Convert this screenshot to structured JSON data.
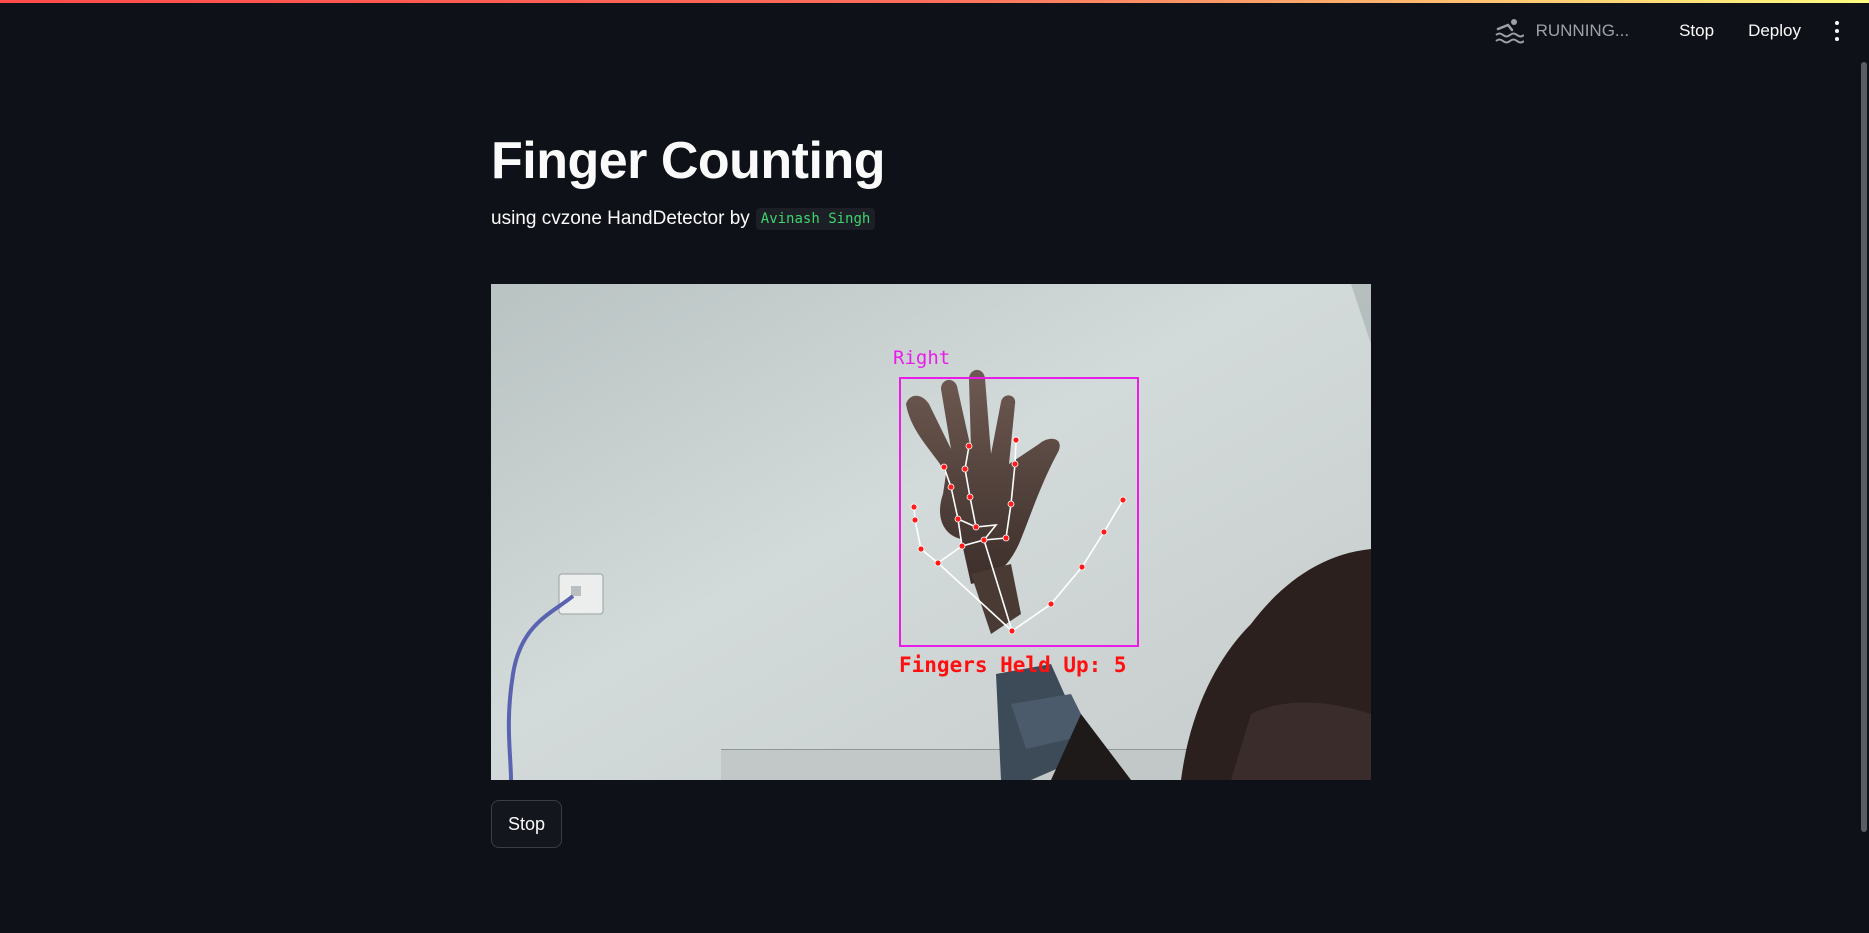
{
  "toolbar": {
    "status_icon": "swimmer-icon",
    "status_text": "RUNNING...",
    "stop_label": "Stop",
    "deploy_label": "Deploy",
    "menu_icon": "kebab-menu-icon"
  },
  "main": {
    "title": "Finger Counting",
    "subtitle_text": "using cvzone HandDetector by",
    "author": "Avinash Singh",
    "video": {
      "hand_label": "Right",
      "count_text": "Fingers Held Up: 5"
    },
    "stop_button_label": "Stop"
  },
  "colors": {
    "background": "#0e1117",
    "accent": "#ff4b4b",
    "code_text": "#3dd56d",
    "bbox": "#e81ee8",
    "overlay_text": "#ff1010"
  }
}
